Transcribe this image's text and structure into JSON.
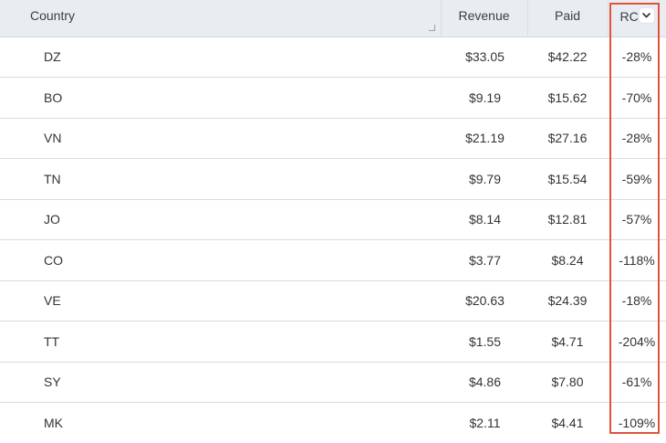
{
  "table": {
    "headers": {
      "country": "Country",
      "revenue": "Revenue",
      "paid": "Paid",
      "roi": "RC"
    },
    "rows": [
      {
        "country": "DZ",
        "revenue": "$33.05",
        "paid": "$42.22",
        "roi": "-28%"
      },
      {
        "country": "BO",
        "revenue": "$9.19",
        "paid": "$15.62",
        "roi": "-70%"
      },
      {
        "country": "VN",
        "revenue": "$21.19",
        "paid": "$27.16",
        "roi": "-28%"
      },
      {
        "country": "TN",
        "revenue": "$9.79",
        "paid": "$15.54",
        "roi": "-59%"
      },
      {
        "country": "JO",
        "revenue": "$8.14",
        "paid": "$12.81",
        "roi": "-57%"
      },
      {
        "country": "CO",
        "revenue": "$3.77",
        "paid": "$8.24",
        "roi": "-118%"
      },
      {
        "country": "VE",
        "revenue": "$20.63",
        "paid": "$24.39",
        "roi": "-18%"
      },
      {
        "country": "TT",
        "revenue": "$1.55",
        "paid": "$4.71",
        "roi": "-204%"
      },
      {
        "country": "SY",
        "revenue": "$4.86",
        "paid": "$7.80",
        "roi": "-61%"
      },
      {
        "country": "MK",
        "revenue": "$2.11",
        "paid": "$4.41",
        "roi": "-109%"
      }
    ]
  },
  "icons": {
    "sort": "chevron-down-icon",
    "resize": "column-resize-icon"
  },
  "colors": {
    "header_bg": "#e9edf2",
    "highlight": "#e0533a"
  }
}
